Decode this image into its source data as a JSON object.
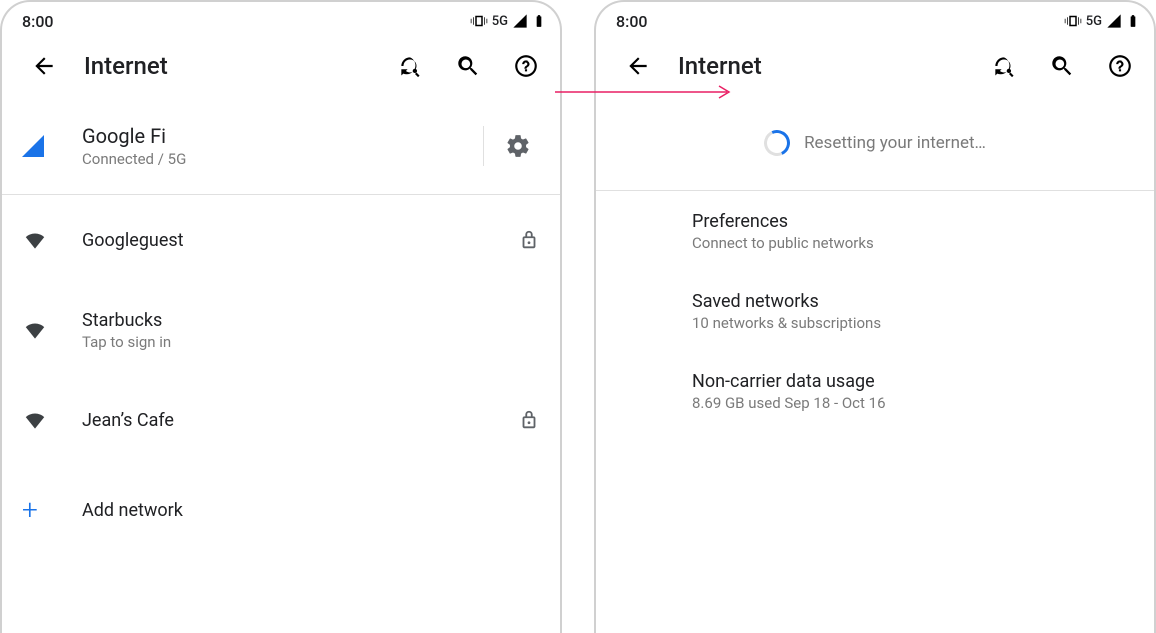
{
  "status": {
    "time": "8:00",
    "network_label": "5G"
  },
  "header": {
    "title": "Internet"
  },
  "left_panel": {
    "carrier": {
      "name": "Google Fi",
      "status": "Connected / 5G"
    },
    "networks": [
      {
        "name": "Googleguest",
        "secondary": "",
        "locked": true
      },
      {
        "name": "Starbucks",
        "secondary": "Tap to sign in",
        "locked": false
      },
      {
        "name": "Jean’s Cafe",
        "secondary": "",
        "locked": true
      }
    ],
    "add_network_label": "Add network"
  },
  "right_panel": {
    "resetting_label": "Resetting your internet…",
    "settings": [
      {
        "title": "Preferences",
        "subtitle": "Connect to public networks"
      },
      {
        "title": "Saved networks",
        "subtitle": "10 networks & subscriptions"
      },
      {
        "title": "Non-carrier data usage",
        "subtitle": "8.69 GB used Sep 18 - Oct 16"
      }
    ]
  }
}
